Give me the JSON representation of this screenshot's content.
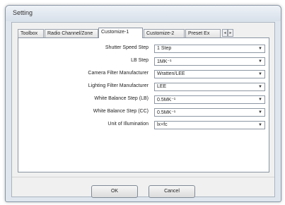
{
  "window": {
    "title": "Setting"
  },
  "tabs": [
    {
      "label": "Toolbox"
    },
    {
      "label": "Radio Channel/Zone"
    },
    {
      "label": "Customize-1",
      "active": true
    },
    {
      "label": "Customize-2"
    },
    {
      "label": "Preset Ex"
    }
  ],
  "tab_scroll": {
    "left_icon": "triangle-left-icon",
    "right_icon": "triangle-right-icon"
  },
  "settings": [
    {
      "label": "Shutter Speed Step",
      "value": "1 Step"
    },
    {
      "label": "LB Step",
      "value": "1MK⁻¹"
    },
    {
      "label": "Camera Filter Manufacturer",
      "value": "Wratten/LEE"
    },
    {
      "label": "Lighting Filter Manufacturer",
      "value": "LEE"
    },
    {
      "label": "White Balance Step (LB)",
      "value": "0.5MK⁻¹"
    },
    {
      "label": "White Balance Step (CC)",
      "value": "0.5MK⁻¹"
    },
    {
      "label": "Unit of Illumination",
      "value": "lx+fc"
    }
  ],
  "buttons": {
    "ok": "OK",
    "cancel": "Cancel"
  }
}
